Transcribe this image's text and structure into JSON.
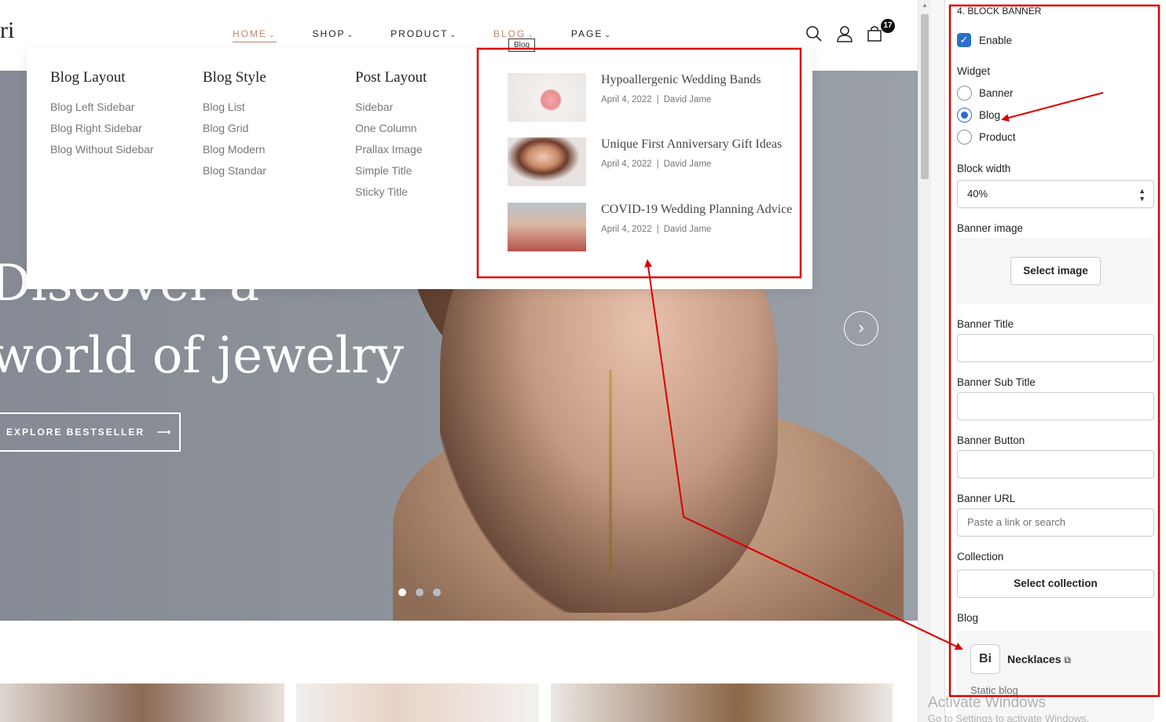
{
  "header": {
    "logo_text": "ri",
    "nav": [
      {
        "label": "HOME",
        "active": true
      },
      {
        "label": "SHOP"
      },
      {
        "label": "PRODUCT"
      },
      {
        "label": "BLOG"
      },
      {
        "label": "PAGE"
      }
    ],
    "tooltip": "Blog",
    "cart_count": "17",
    "icons": [
      "search-icon",
      "user-icon",
      "cart-icon"
    ]
  },
  "mega_menu": {
    "columns": [
      {
        "title": "Blog Layout",
        "links": [
          "Blog Left Sidebar",
          "Blog Right Sidebar",
          "Blog Without Sidebar"
        ]
      },
      {
        "title": "Blog Style",
        "links": [
          "Blog List",
          "Blog Grid",
          "Blog Modern",
          "Blog Standar"
        ]
      },
      {
        "title": "Post Layout",
        "links": [
          "Sidebar",
          "One Column",
          "Prallax Image",
          "Simple Title",
          "Sticky Title"
        ]
      }
    ],
    "posts": [
      {
        "title": "Hypoallergenic Wedding Bands",
        "date": "April 4, 2022",
        "author": "David Jame"
      },
      {
        "title": "Unique First Anniversary Gift Ideas",
        "date": "April 4, 2022",
        "author": "David Jame"
      },
      {
        "title": "COVID-19 Wedding Planning Advice",
        "date": "April 4, 2022",
        "author": "David Jame"
      }
    ]
  },
  "hero": {
    "title_line1": "Discover a",
    "title_line2": "world of jewelry",
    "button_label": "EXPLORE BESTSELLER",
    "slides": 3,
    "active_slide": 1
  },
  "panel": {
    "section_title": "4. BLOCK BANNER",
    "enable_label": "Enable",
    "enable_checked": true,
    "widget_label": "Widget",
    "widget_options": [
      "Banner",
      "Blog",
      "Product"
    ],
    "widget_selected": "Blog",
    "block_width_label": "Block width",
    "block_width_value": "40%",
    "banner_image_label": "Banner image",
    "select_image_label": "Select image",
    "banner_title_label": "Banner Title",
    "banner_title_value": "",
    "banner_subtitle_label": "Banner Sub Title",
    "banner_subtitle_value": "",
    "banner_button_label": "Banner Button",
    "banner_button_value": "",
    "banner_url_label": "Banner URL",
    "banner_url_placeholder": "Paste a link or search",
    "collection_label": "Collection",
    "select_collection_label": "Select collection",
    "blog_label": "Blog",
    "blog_icon_text": "Bi",
    "blog_name": "Necklaces",
    "blog_type": "Static blog"
  },
  "watermark": {
    "line1": "Activate Windows",
    "line2": "Go to Settings to activate Windows."
  },
  "colors": {
    "accent": "#c0856b",
    "annotation": "#d90000",
    "checkbox": "#2c6ecb"
  }
}
